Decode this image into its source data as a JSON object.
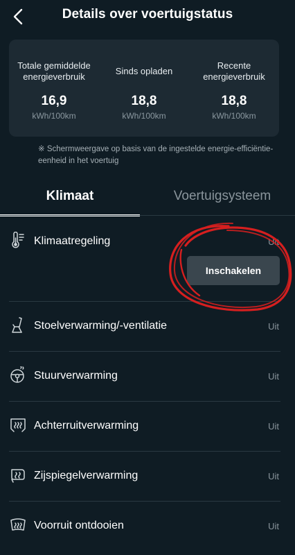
{
  "header": {
    "title": "Details over voertuigstatus",
    "back_icon": "chevron-left-icon"
  },
  "stats": [
    {
      "label": "Totale gemiddelde energieverbruik",
      "value": "16,9",
      "unit": "kWh/100km"
    },
    {
      "label": "Sinds opladen",
      "value": "18,8",
      "unit": "kWh/100km"
    },
    {
      "label": "Recente energieverbruik",
      "value": "18,8",
      "unit": "kWh/100km"
    }
  ],
  "note": "※ Schermweergave op basis van de ingestelde energie-efficiëntie-eenheid in het voertuig",
  "tabs": [
    {
      "label": "Klimaat",
      "active": true
    },
    {
      "label": "Voertuigsysteem",
      "active": false
    }
  ],
  "items": [
    {
      "label": "Klimaatregeling",
      "status": "Uit",
      "icon": "thermometer-icon"
    },
    {
      "label": "Stoelverwarming/-ventilatie",
      "status": "Uit",
      "icon": "seat-icon"
    },
    {
      "label": "Stuurverwarming",
      "status": "Uit",
      "icon": "steering-wheel-icon"
    },
    {
      "label": "Achterruitverwarming",
      "status": "Uit",
      "icon": "rear-window-defrost-icon"
    },
    {
      "label": "Zijspiegelverwarming",
      "status": "Uit",
      "icon": "mirror-heat-icon"
    },
    {
      "label": "Voorruit ontdooien",
      "status": "Uit",
      "icon": "windshield-defrost-icon"
    }
  ],
  "climate_action": {
    "label": "Inschakelen"
  },
  "colors": {
    "background": "#0f1c24",
    "card": "#1d2a33",
    "button": "#3a464e",
    "annotation": "#d61f1f"
  }
}
